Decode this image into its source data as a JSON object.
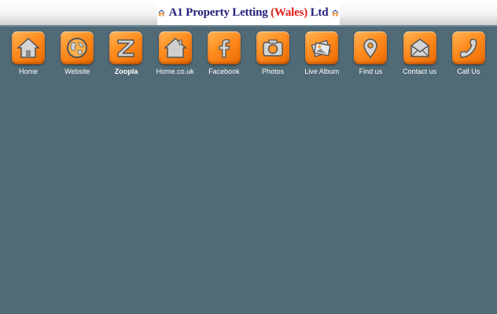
{
  "header": {
    "logo_prefix": "A1 Property Letting ",
    "logo_accent": "(Wales)",
    "logo_suffix": " Ltd"
  },
  "colors": {
    "background": "#506a76",
    "tile_orange": "#ff8c1f",
    "logo_blue": "#24207a",
    "logo_red": "#e0201a"
  },
  "nav": [
    {
      "label": "Home",
      "icon": "house-icon"
    },
    {
      "label": "Website",
      "icon": "globe-icon"
    },
    {
      "label": "Zoopla",
      "icon": "zoopla-z-icon"
    },
    {
      "label": "Home.co.uk",
      "icon": "house-outline-icon"
    },
    {
      "label": "Facebook",
      "icon": "facebook-icon"
    },
    {
      "label": "Photos",
      "icon": "camera-icon"
    },
    {
      "label": "Live Album",
      "icon": "photo-album-icon"
    },
    {
      "label": "Find us",
      "icon": "map-pin-icon"
    },
    {
      "label": "Contact us",
      "icon": "envelope-icon"
    },
    {
      "label": "Call Us",
      "icon": "phone-icon"
    }
  ]
}
